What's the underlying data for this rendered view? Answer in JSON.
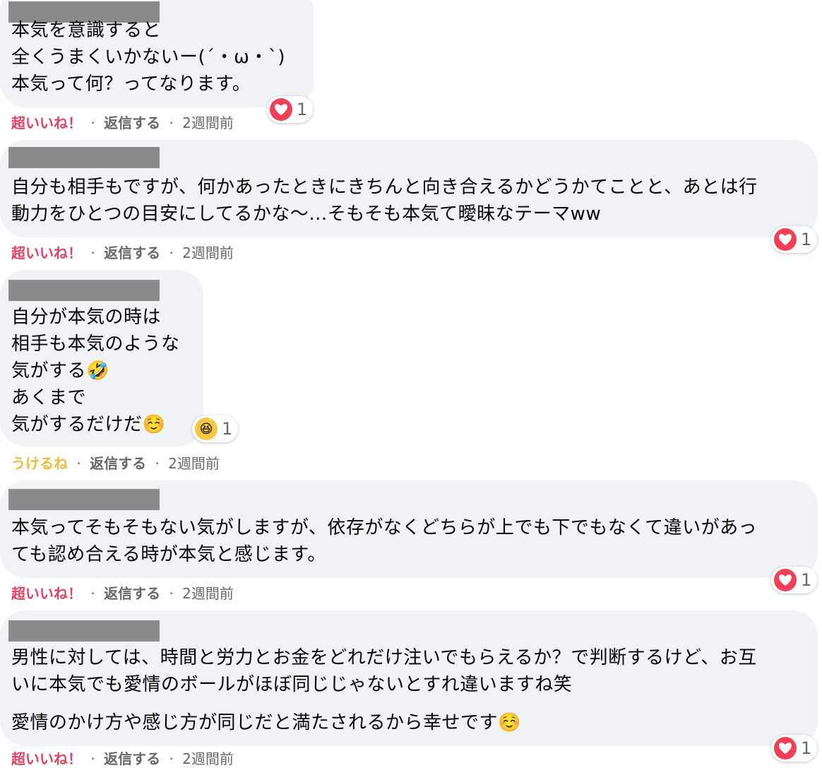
{
  "comments": [
    {
      "lines": [
        "本気を意識すると",
        "全くうまくいかないー(´・ω・`)",
        "本気って何？ってなります。"
      ],
      "reaction_label": "超いいね！",
      "reply_label": "返信する",
      "time": "2週間前",
      "reaction_icon": "heart-icon",
      "reaction_count": "1"
    },
    {
      "lines": [
        "自分も相手もですが、何かあったときにきちんと向き合えるかどうかてことと、あとは行",
        "動力をひとつの目安にしてるかな〜...そもそも本気て曖昧なテーマww"
      ],
      "reaction_label": "超いいね！",
      "reply_label": "返信する",
      "time": "2週間前",
      "reaction_icon": "heart-icon",
      "reaction_count": "1"
    },
    {
      "lines": [
        "自分が本気の時は",
        "相手も本気のような",
        "気がする🤣",
        "あくまで",
        "気がするだけだ☺️"
      ],
      "reaction_label": "うけるね",
      "reply_label": "返信する",
      "time": "2週間前",
      "reaction_icon": "haha-icon",
      "reaction_count": "1"
    },
    {
      "lines": [
        "本気ってそもそもない気がしますが、依存がなくどちらが上でも下でもなくて違いがあっ",
        "ても認め合える時が本気と感じます。"
      ],
      "reaction_label": "超いいね！",
      "reply_label": "返信する",
      "time": "2週間前",
      "reaction_icon": "heart-icon",
      "reaction_count": "1"
    },
    {
      "lines": [
        "男性に対しては、時間と労力とお金をどれだけ注いでもらえるか？で判断するけど、お互",
        "いに本気でも愛情のボールがほぼ同じじゃないとすれ違いますね笑"
      ],
      "extra_line": "愛情のかけ方や感じ方が同じだと満たされるから幸せです☺️",
      "reaction_label": "超いいね！",
      "reply_label": "返信する",
      "time": "2週間前",
      "reaction_icon": "heart-icon",
      "reaction_count": "1"
    }
  ],
  "separator": "·",
  "colors": {
    "bubble": "#f0f2f5",
    "love": "#e4405f",
    "haha": "#f0b93a",
    "meta": "#65676b"
  }
}
